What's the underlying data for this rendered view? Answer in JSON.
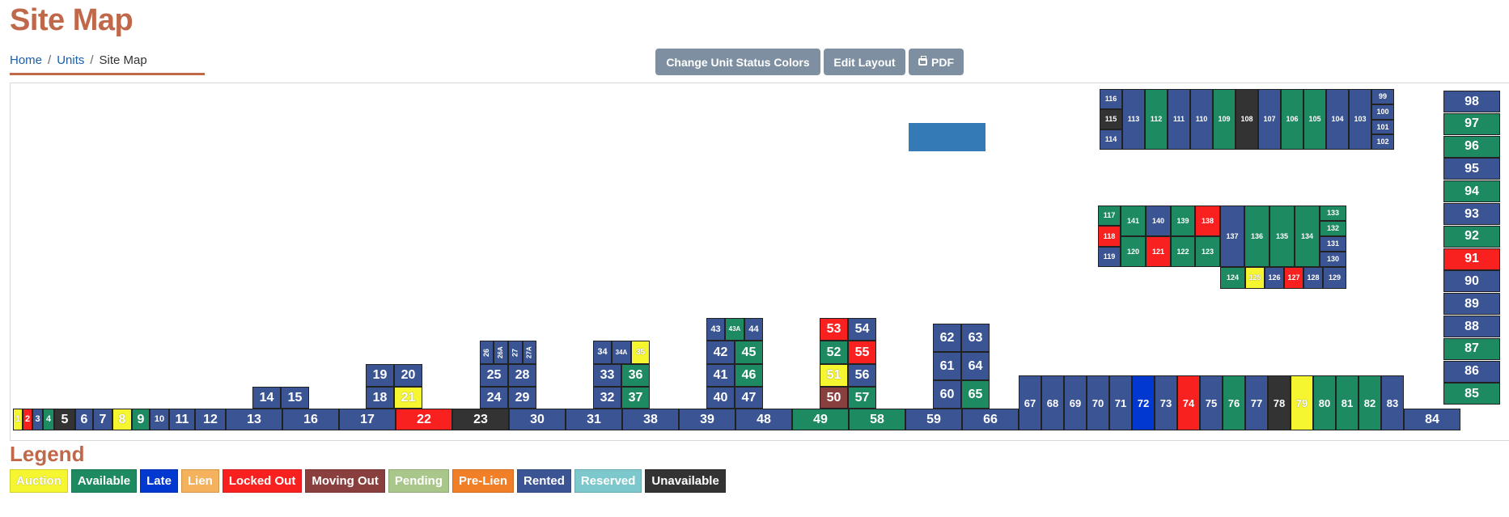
{
  "page": {
    "title": "Site Map"
  },
  "breadcrumb": {
    "home": "Home",
    "units": "Units",
    "current": "Site Map",
    "separator": "/"
  },
  "toolbar": {
    "change_colors_label": "Change Unit Status Colors",
    "edit_layout_label": "Edit Layout",
    "pdf_label": "PDF"
  },
  "colors": {
    "Auction": "#f5f530",
    "Available": "#1e8a62",
    "Late": "#0038d0",
    "Lien": "#f4b25c",
    "Locked Out": "#f92020",
    "Moving Out": "#8a3f3f",
    "Pending": "#a9c68b",
    "Pre-Lien": "#f07f28",
    "Rented": "#3b5594",
    "Reserved": "#7cc8cc",
    "Unavailable": "#333333"
  },
  "legend": {
    "title": "Legend",
    "items": [
      "Auction",
      "Available",
      "Late",
      "Lien",
      "Locked Out",
      "Moving Out",
      "Pending",
      "Pre-Lien",
      "Rented",
      "Reserved",
      "Unavailable"
    ]
  },
  "units": [
    {
      "id": "1",
      "status": "Auction"
    },
    {
      "id": "2",
      "status": "Locked Out"
    },
    {
      "id": "3",
      "status": "Rented"
    },
    {
      "id": "4",
      "status": "Available"
    },
    {
      "id": "5",
      "status": "Unavailable"
    },
    {
      "id": "6",
      "status": "Rented"
    },
    {
      "id": "7",
      "status": "Rented"
    },
    {
      "id": "8",
      "status": "Auction"
    },
    {
      "id": "9",
      "status": "Available"
    },
    {
      "id": "10",
      "status": "Rented"
    },
    {
      "id": "11",
      "status": "Rented"
    },
    {
      "id": "12",
      "status": "Rented"
    },
    {
      "id": "13",
      "status": "Rented"
    },
    {
      "id": "16",
      "status": "Rented"
    },
    {
      "id": "17",
      "status": "Rented"
    },
    {
      "id": "22",
      "status": "Locked Out"
    },
    {
      "id": "23",
      "status": "Unavailable"
    },
    {
      "id": "30",
      "status": "Rented"
    },
    {
      "id": "31",
      "status": "Rented"
    },
    {
      "id": "38",
      "status": "Rented"
    },
    {
      "id": "39",
      "status": "Rented"
    },
    {
      "id": "48",
      "status": "Rented"
    },
    {
      "id": "49",
      "status": "Available"
    },
    {
      "id": "58",
      "status": "Available"
    },
    {
      "id": "59",
      "status": "Rented"
    },
    {
      "id": "66",
      "status": "Rented"
    },
    {
      "id": "84",
      "status": "Rented"
    },
    {
      "id": "14",
      "status": "Rented"
    },
    {
      "id": "15",
      "status": "Rented"
    },
    {
      "id": "19",
      "status": "Rented"
    },
    {
      "id": "20",
      "status": "Rented"
    },
    {
      "id": "18",
      "status": "Rented"
    },
    {
      "id": "21",
      "status": "Auction"
    },
    {
      "id": "26",
      "status": "Rented"
    },
    {
      "id": "26A",
      "status": "Rented"
    },
    {
      "id": "27",
      "status": "Rented"
    },
    {
      "id": "27A",
      "status": "Rented"
    },
    {
      "id": "25",
      "status": "Rented"
    },
    {
      "id": "28",
      "status": "Rented"
    },
    {
      "id": "24",
      "status": "Rented"
    },
    {
      "id": "29",
      "status": "Rented"
    },
    {
      "id": "34",
      "status": "Rented"
    },
    {
      "id": "34A",
      "status": "Rented"
    },
    {
      "id": "35",
      "status": "Auction"
    },
    {
      "id": "33",
      "status": "Rented"
    },
    {
      "id": "36",
      "status": "Available"
    },
    {
      "id": "32",
      "status": "Rented"
    },
    {
      "id": "37",
      "status": "Available"
    },
    {
      "id": "43",
      "status": "Rented"
    },
    {
      "id": "43A",
      "status": "Available"
    },
    {
      "id": "44",
      "status": "Rented"
    },
    {
      "id": "42",
      "status": "Rented"
    },
    {
      "id": "45",
      "status": "Available"
    },
    {
      "id": "41",
      "status": "Rented"
    },
    {
      "id": "46",
      "status": "Available"
    },
    {
      "id": "40",
      "status": "Rented"
    },
    {
      "id": "47",
      "status": "Rented"
    },
    {
      "id": "53",
      "status": "Locked Out"
    },
    {
      "id": "54",
      "status": "Rented"
    },
    {
      "id": "52",
      "status": "Available"
    },
    {
      "id": "55",
      "status": "Locked Out"
    },
    {
      "id": "51",
      "status": "Auction"
    },
    {
      "id": "56",
      "status": "Rented"
    },
    {
      "id": "50",
      "status": "Moving Out"
    },
    {
      "id": "57",
      "status": "Available"
    },
    {
      "id": "62",
      "status": "Rented"
    },
    {
      "id": "63",
      "status": "Rented"
    },
    {
      "id": "61",
      "status": "Rented"
    },
    {
      "id": "64",
      "status": "Rented"
    },
    {
      "id": "60",
      "status": "Rented"
    },
    {
      "id": "65",
      "status": "Available"
    },
    {
      "id": "67",
      "status": "Rented"
    },
    {
      "id": "68",
      "status": "Rented"
    },
    {
      "id": "69",
      "status": "Rented"
    },
    {
      "id": "70",
      "status": "Rented"
    },
    {
      "id": "71",
      "status": "Rented"
    },
    {
      "id": "72",
      "status": "Late"
    },
    {
      "id": "73",
      "status": "Rented"
    },
    {
      "id": "74",
      "status": "Locked Out"
    },
    {
      "id": "75",
      "status": "Rented"
    },
    {
      "id": "76",
      "status": "Available"
    },
    {
      "id": "77",
      "status": "Rented"
    },
    {
      "id": "78",
      "status": "Unavailable"
    },
    {
      "id": "79",
      "status": "Auction"
    },
    {
      "id": "80",
      "status": "Available"
    },
    {
      "id": "81",
      "status": "Available"
    },
    {
      "id": "82",
      "status": "Available"
    },
    {
      "id": "83",
      "status": "Rented"
    },
    {
      "id": "98",
      "status": "Rented"
    },
    {
      "id": "97",
      "status": "Available"
    },
    {
      "id": "96",
      "status": "Available"
    },
    {
      "id": "95",
      "status": "Rented"
    },
    {
      "id": "94",
      "status": "Available"
    },
    {
      "id": "93",
      "status": "Rented"
    },
    {
      "id": "92",
      "status": "Available"
    },
    {
      "id": "91",
      "status": "Locked Out"
    },
    {
      "id": "90",
      "status": "Rented"
    },
    {
      "id": "89",
      "status": "Rented"
    },
    {
      "id": "88",
      "status": "Rented"
    },
    {
      "id": "87",
      "status": "Available"
    },
    {
      "id": "86",
      "status": "Rented"
    },
    {
      "id": "85",
      "status": "Available"
    },
    {
      "id": "116",
      "status": "Rented"
    },
    {
      "id": "115",
      "status": "Unavailable"
    },
    {
      "id": "114",
      "status": "Rented"
    },
    {
      "id": "113",
      "status": "Rented"
    },
    {
      "id": "112",
      "status": "Available"
    },
    {
      "id": "111",
      "status": "Rented"
    },
    {
      "id": "110",
      "status": "Rented"
    },
    {
      "id": "109",
      "status": "Available"
    },
    {
      "id": "108",
      "status": "Unavailable"
    },
    {
      "id": "107",
      "status": "Rented"
    },
    {
      "id": "106",
      "status": "Available"
    },
    {
      "id": "105",
      "status": "Available"
    },
    {
      "id": "104",
      "status": "Rented"
    },
    {
      "id": "103",
      "status": "Rented"
    },
    {
      "id": "99",
      "status": "Rented"
    },
    {
      "id": "100",
      "status": "Rented"
    },
    {
      "id": "101",
      "status": "Rented"
    },
    {
      "id": "102",
      "status": "Rented"
    },
    {
      "id": "117",
      "status": "Available"
    },
    {
      "id": "118",
      "status": "Locked Out"
    },
    {
      "id": "119",
      "status": "Rented"
    },
    {
      "id": "141",
      "status": "Available"
    },
    {
      "id": "140",
      "status": "Rented"
    },
    {
      "id": "139",
      "status": "Available"
    },
    {
      "id": "138",
      "status": "Locked Out"
    },
    {
      "id": "120",
      "status": "Available"
    },
    {
      "id": "121",
      "status": "Locked Out"
    },
    {
      "id": "122",
      "status": "Available"
    },
    {
      "id": "123",
      "status": "Available"
    },
    {
      "id": "137",
      "status": "Rented"
    },
    {
      "id": "136",
      "status": "Available"
    },
    {
      "id": "135",
      "status": "Available"
    },
    {
      "id": "134",
      "status": "Available"
    },
    {
      "id": "133",
      "status": "Available"
    },
    {
      "id": "132",
      "status": "Available"
    },
    {
      "id": "131",
      "status": "Rented"
    },
    {
      "id": "130",
      "status": "Rented"
    },
    {
      "id": "124",
      "status": "Available"
    },
    {
      "id": "125",
      "status": "Auction"
    },
    {
      "id": "126",
      "status": "Rented"
    },
    {
      "id": "127",
      "status": "Locked Out"
    },
    {
      "id": "128",
      "status": "Rented"
    },
    {
      "id": "129",
      "status": "Rented"
    }
  ]
}
